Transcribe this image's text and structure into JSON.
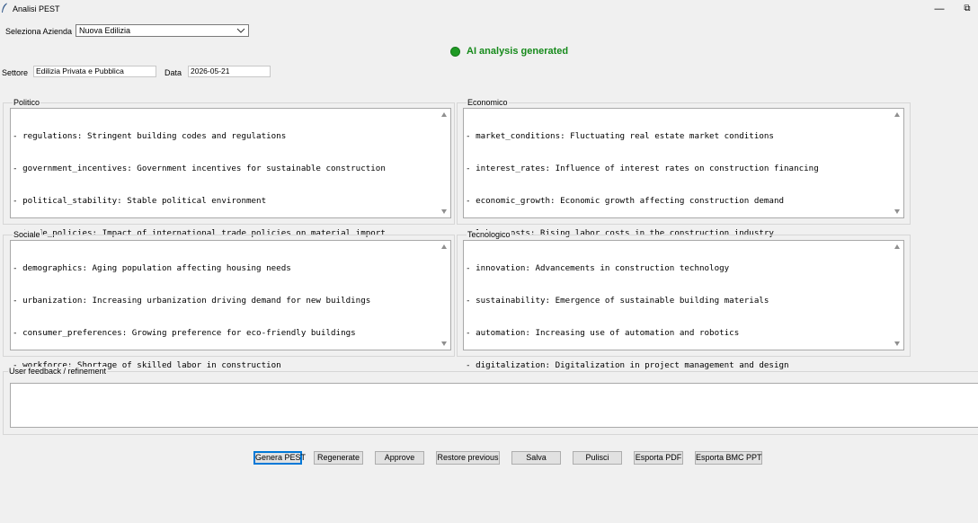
{
  "window": {
    "title": "Analisi PEST",
    "minimize_glyph": "—",
    "restore_glyph": "⧉"
  },
  "company": {
    "label": "Seleziona Azienda",
    "selected": "Nuova Edilizia"
  },
  "status": {
    "text": "AI analysis generated",
    "color": "#168a1b"
  },
  "sector": {
    "label": "Settore",
    "value": "Edilizia Privata e Pubblica"
  },
  "date": {
    "label": "Data",
    "value": "2026-05-21"
  },
  "panels": {
    "politico": {
      "label": "Politico",
      "lines": [
        "- regulations: Stringent building codes and regulations",
        "- government_incentives: Government incentives for sustainable construction",
        "- political_stability: Stable political environment",
        "- trade_policies: Impact of international trade policies on material import"
      ]
    },
    "economico": {
      "label": "Economico",
      "lines": [
        "- market_conditions: Fluctuating real estate market conditions",
        "- interest_rates: Influence of interest rates on construction financing",
        "- economic_growth: Economic growth affecting construction demand",
        "- labor_costs: Rising labor costs in the construction industry"
      ]
    },
    "sociale": {
      "label": "Sociale",
      "lines": [
        "- demographics: Aging population affecting housing needs",
        "- urbanization: Increasing urbanization driving demand for new buildings",
        "- consumer_preferences: Growing preference for eco-friendly buildings",
        "- workforce: Shortage of skilled labor in construction"
      ]
    },
    "tecnologico": {
      "label": "Tecnologico",
      "lines": [
        "- innovation: Advancements in construction technology",
        "- sustainability: Emergence of sustainable building materials",
        "- automation: Increasing use of automation and robotics",
        "- digitalization: Digitalization in project management and design"
      ]
    }
  },
  "feedback": {
    "label": "User feedback / refinement",
    "value": ""
  },
  "buttons": {
    "genera": "Genera PEST",
    "regenerate": "Regenerate",
    "approve": "Approve",
    "restore": "Restore previous",
    "salva": "Salva",
    "pulisci": "Pulisci",
    "pdf": "Esporta PDF",
    "bmc": "Esporta BMC PPT"
  }
}
